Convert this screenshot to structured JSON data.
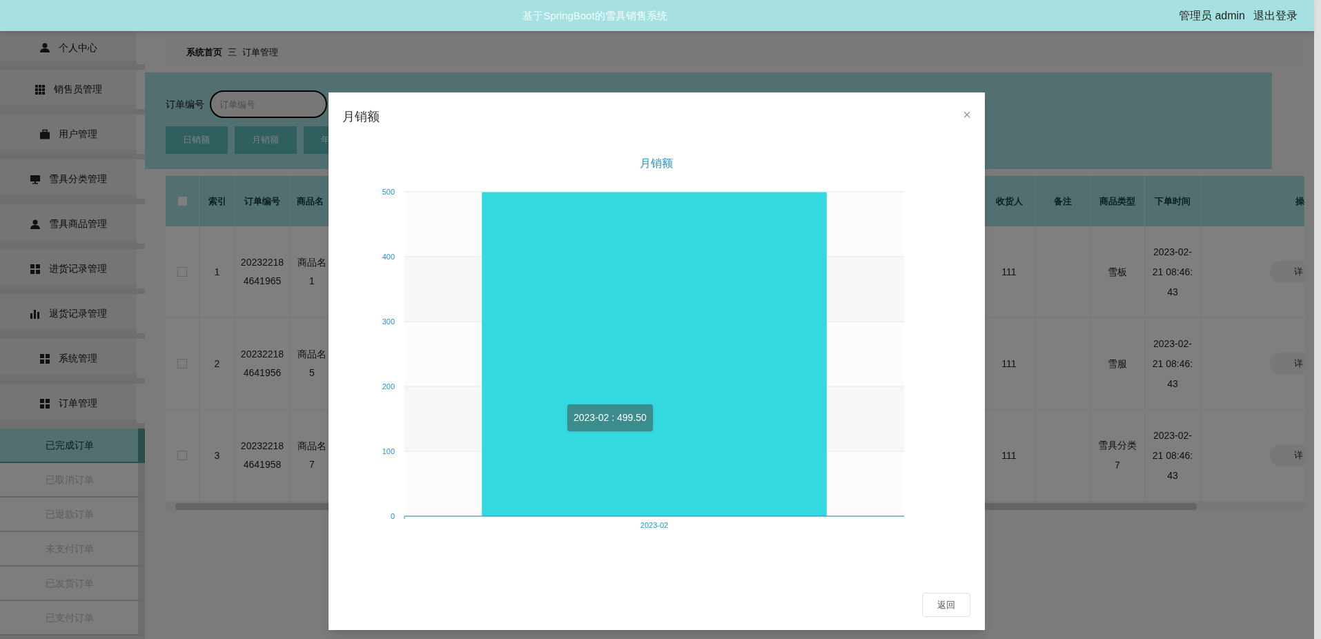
{
  "header": {
    "title": "基于SpringBoot的雪具销售系统",
    "user": "管理员 admin",
    "logout": "退出登录"
  },
  "sidebar": {
    "items": [
      {
        "label": "个人中心"
      },
      {
        "label": "销售员管理"
      },
      {
        "label": "用户管理"
      },
      {
        "label": "雪具分类管理"
      },
      {
        "label": "雪具商品管理"
      },
      {
        "label": "进货记录管理"
      },
      {
        "label": "退货记录管理"
      },
      {
        "label": "系统管理"
      },
      {
        "label": "订单管理"
      }
    ],
    "submenu": [
      {
        "label": "已完成订单",
        "selected": true
      },
      {
        "label": "已取消订单",
        "selected": false
      },
      {
        "label": "已退款订单",
        "selected": false
      },
      {
        "label": "未支付订单",
        "selected": false
      },
      {
        "label": "已发货订单",
        "selected": false
      },
      {
        "label": "已支付订单",
        "selected": false
      }
    ]
  },
  "breadcrumb": {
    "home": "系统首页",
    "separator": "三",
    "current": "订单管理"
  },
  "search": {
    "label": "订单编号",
    "placeholder": "订单编号"
  },
  "buttons": [
    "日销额",
    "月销额",
    "年"
  ],
  "table": {
    "all_checked": false,
    "columns": [
      "索引",
      "订单编号",
      "商品名",
      "收货人",
      "备注",
      "商品类型",
      "下单时间",
      "操"
    ],
    "rows": [
      {
        "checked": false,
        "cells": [
          "1",
          "202322184641965",
          "商品名1",
          "111",
          "",
          "雪板",
          "2023-02-21 08:46:43"
        ],
        "action": "详"
      },
      {
        "checked": false,
        "cells": [
          "2",
          "202322184641956",
          "商品名5",
          "111",
          "",
          "雪服",
          "2023-02-21 08:46:43"
        ],
        "action": "详"
      },
      {
        "checked": false,
        "cells": [
          "3",
          "202322184641958",
          "商品名7",
          "111",
          "",
          "雪具分类7",
          "2023-02-21 08:46:43"
        ],
        "action": "详"
      }
    ]
  },
  "dialog": {
    "title": "月销额",
    "close": "×",
    "button": "返回",
    "chart_data": {
      "type": "bar",
      "title": "月销额",
      "categories": [
        "2023-02"
      ],
      "series": [
        {
          "color": "#33d9de",
          "values": [
            499.5
          ]
        }
      ],
      "grid": true,
      "ylim": [
        0,
        500
      ],
      "yticks": [
        0,
        100,
        200,
        300,
        400,
        500
      ],
      "annotations": [
        {
          "text": "2023-02 : 499.50"
        }
      ]
    }
  }
}
